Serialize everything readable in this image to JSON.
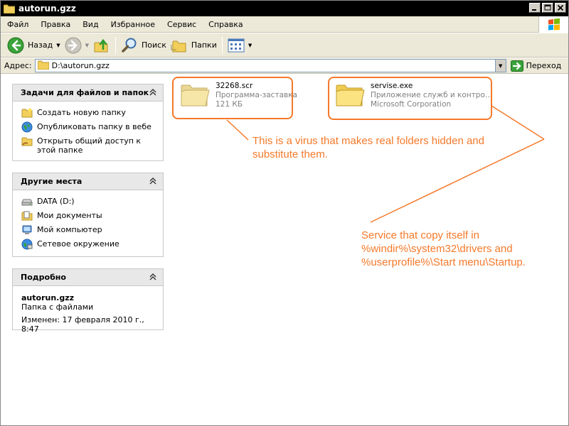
{
  "window": {
    "title": "autorun.gzz"
  },
  "menu": [
    "Файл",
    "Правка",
    "Вид",
    "Избранное",
    "Сервис",
    "Справка"
  ],
  "toolbar": {
    "back_label": "Назад",
    "search_label": "Поиск",
    "folders_label": "Папки"
  },
  "address": {
    "label": "Адрес:",
    "value": "D:\\autorun.gzz",
    "go_label": "Переход"
  },
  "tasks_panel": {
    "title": "Задачи для файлов и папок",
    "items": [
      "Создать новую папку",
      "Опубликовать папку в вебе",
      "Открыть общий доступ к этой папке"
    ]
  },
  "places_panel": {
    "title": "Другие места",
    "items": [
      "DATA (D:)",
      "Мои документы",
      "Мой компьютер",
      "Сетевое окружение"
    ]
  },
  "details_panel": {
    "title": "Подробно",
    "name": "autorun.gzz",
    "type": "Папка с файлами",
    "modified": "Изменен: 17 февраля 2010 г., 8:47"
  },
  "files": [
    {
      "name": "32268.scr",
      "line2": "Программа-заставка",
      "line3": "121 КБ"
    },
    {
      "name": "servise.exe",
      "line2": "Приложение служб и контро...",
      "line3": "Microsoft Corporation"
    }
  ],
  "annotations": {
    "virus_note": [
      "This is a virus that makes real folders hidden and",
      "substitute them."
    ],
    "service_note": [
      "Service that copy itself in",
      "%windir%\\system32\\drivers and",
      "%userprofile%\\Start menu\\Startup."
    ],
    "color": "#f5792a"
  },
  "colors": {
    "titlebar": "#000000",
    "chrome": "#ece9d8",
    "panel_head": "#e8e8e8"
  }
}
